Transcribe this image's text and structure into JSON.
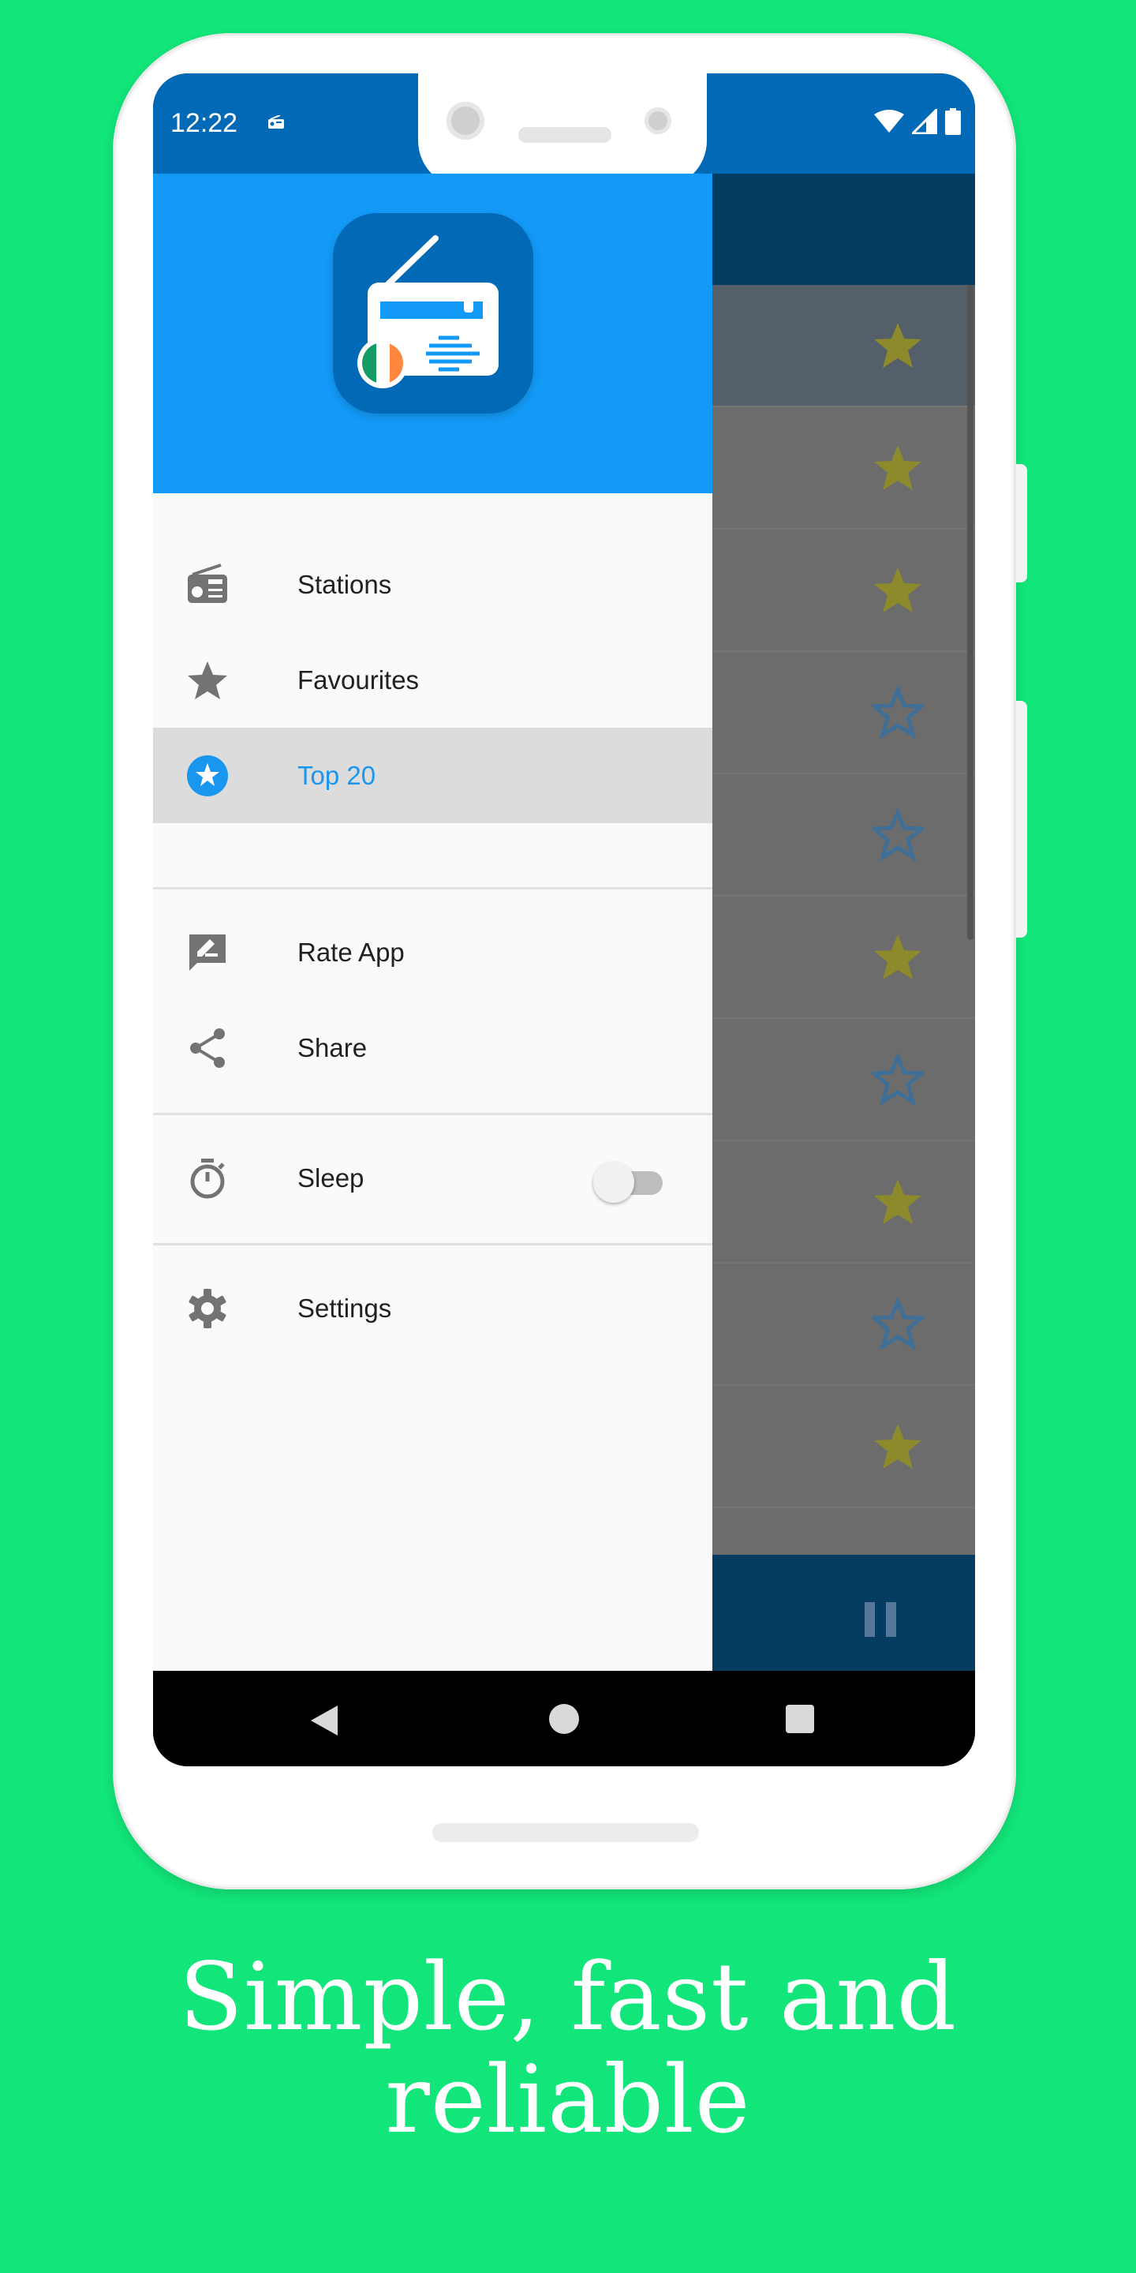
{
  "status_bar": {
    "time": "12:22",
    "icons": [
      "radio-icon",
      "wifi-icon",
      "signal-icon",
      "battery-icon"
    ]
  },
  "drawer": {
    "logo": "radio-ireland-app-logo",
    "items": [
      {
        "label": "Stations",
        "icon": "radio-icon",
        "active": false
      },
      {
        "label": "Favourites",
        "icon": "star-icon",
        "active": false
      },
      {
        "label": "Top 20",
        "icon": "star-circle-icon",
        "active": true
      },
      {
        "label": "Rate App",
        "icon": "rate-review-icon",
        "active": false
      },
      {
        "label": "Share",
        "icon": "share-icon",
        "active": false
      },
      {
        "label": "Sleep",
        "icon": "timer-icon",
        "active": false,
        "toggle": false
      },
      {
        "label": "Settings",
        "icon": "gear-icon",
        "active": false
      }
    ]
  },
  "background_list": {
    "rows": [
      {
        "favourite": true
      },
      {
        "favourite": true
      },
      {
        "favourite": true
      },
      {
        "favourite": false
      },
      {
        "favourite": false
      },
      {
        "favourite": true
      },
      {
        "favourite": false
      },
      {
        "favourite": true
      },
      {
        "favourite": false
      },
      {
        "favourite": true
      }
    ],
    "player_state": "playing"
  },
  "colors": {
    "background": "#12e57a",
    "primary": "#1399f6",
    "primary_dark": "#0169b5",
    "accent_star": "#8c8a2b"
  },
  "caption": {
    "line1": "Simple, fast and",
    "line2": "reliable"
  }
}
